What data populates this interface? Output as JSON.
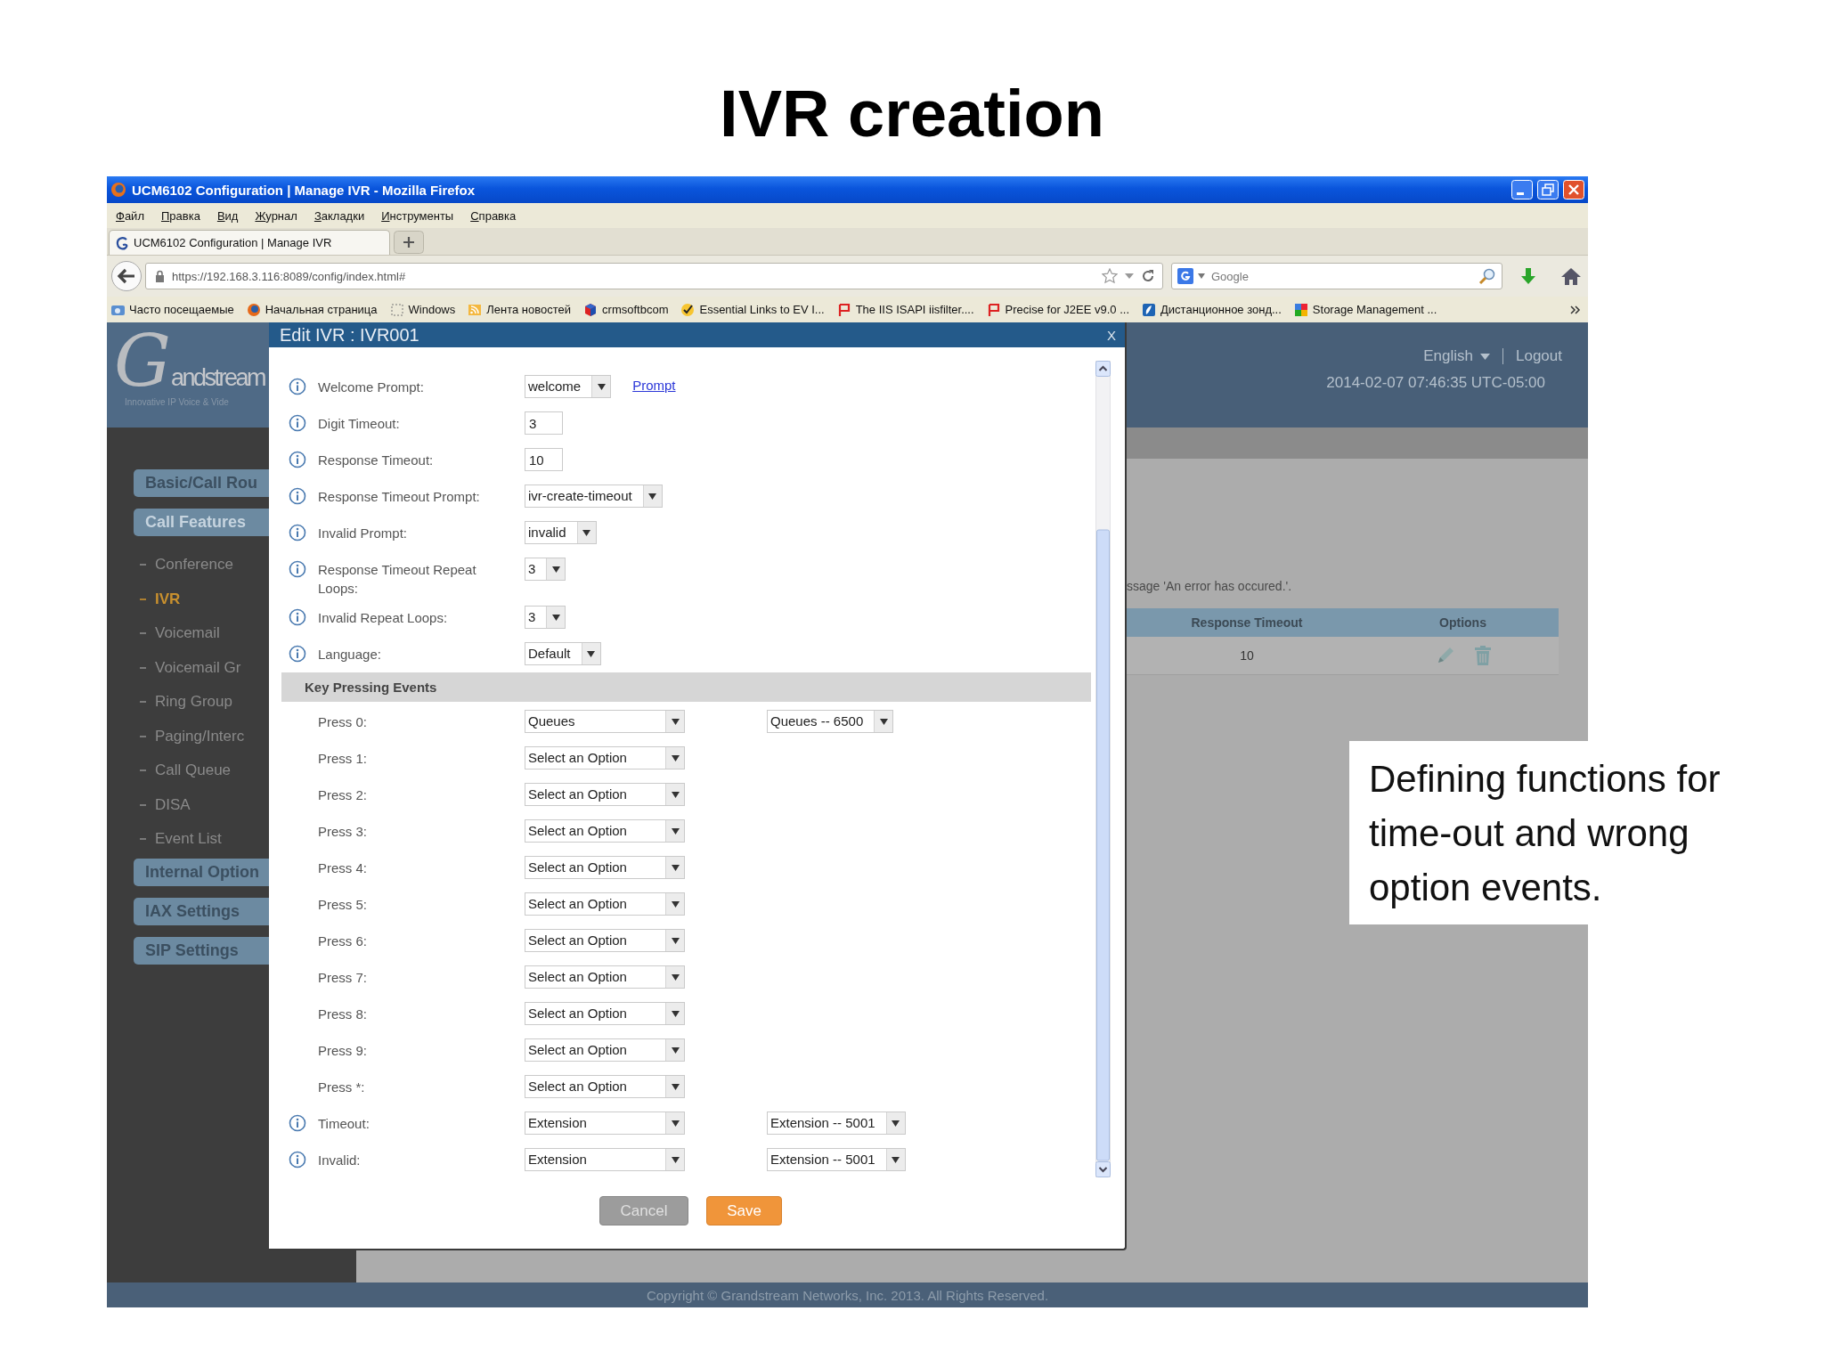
{
  "slide": {
    "title": "IVR creation",
    "callout": "Defining functions for\ntime-out and wrong\noption events."
  },
  "window": {
    "title": "UCM6102 Configuration | Manage IVR - Mozilla Firefox"
  },
  "menu": [
    "Файл",
    "Правка",
    "Вид",
    "Журнал",
    "Закладки",
    "Инструменты",
    "Справка"
  ],
  "tabs": [
    {
      "label": "UCM6102 Configuration | Manage IVR",
      "selected": true
    }
  ],
  "address_bar": {
    "url": "https://192.168.3.116:8089/config/index.html#"
  },
  "search": {
    "placeholder": "Google"
  },
  "bookmarks": [
    {
      "kind": "folder",
      "label": "Часто посещаемые"
    },
    {
      "kind": "globe",
      "label": "Начальная страница"
    },
    {
      "kind": "dashed",
      "label": "Windows"
    },
    {
      "kind": "feed",
      "label": "Лента новостей"
    },
    {
      "kind": "cube",
      "label": "crmsoftbcom"
    },
    {
      "kind": "check",
      "label": "Essential Links to EV I..."
    },
    {
      "kind": "flag",
      "label": "The IIS ISAPI iisfilter...."
    },
    {
      "kind": "flag",
      "label": "Precise for J2EE v9.0 ..."
    },
    {
      "kind": "tile",
      "label": "Дистанционное зонд..."
    },
    {
      "kind": "tiles",
      "label": "Storage Management ..."
    }
  ],
  "app": {
    "logo": {
      "initial": "G",
      "name": "andstream",
      "tagline": "Innovative IP Voice & Vide"
    },
    "language": "English",
    "logout": "Logout",
    "datetime": "2014-02-07 07:46:35 UTC-05:00",
    "sidebar": [
      {
        "kind": "group",
        "label": "Basic/Call Rou",
        "selected": false
      },
      {
        "kind": "group",
        "label": "Call Features",
        "selected": true
      },
      {
        "kind": "item",
        "label": "Conference",
        "selected": false
      },
      {
        "kind": "item",
        "label": "IVR",
        "selected": true
      },
      {
        "kind": "item",
        "label": "Voicemail",
        "selected": false
      },
      {
        "kind": "item",
        "label": "Voicemail Gr",
        "selected": false
      },
      {
        "kind": "item",
        "label": "Ring Group",
        "selected": false
      },
      {
        "kind": "item",
        "label": "Paging/Interc",
        "selected": false
      },
      {
        "kind": "item",
        "label": "Call Queue",
        "selected": false
      },
      {
        "kind": "item",
        "label": "DISA",
        "selected": false
      },
      {
        "kind": "item",
        "label": "Event List",
        "selected": false
      },
      {
        "kind": "group",
        "label": "Internal Option",
        "selected": false
      },
      {
        "kind": "group",
        "label": "IAX Settings",
        "selected": false
      },
      {
        "kind": "group",
        "label": "SIP Settings",
        "selected": false
      }
    ],
    "message": "ssage 'An error has occured.'.",
    "table": {
      "columns": [
        "Response Timeout",
        "Options"
      ],
      "rows": [
        {
          "cells": [
            "10"
          ]
        }
      ]
    },
    "footer": "Copyright © Grandstream Networks, Inc. 2013. All Rights Reserved."
  },
  "dialog": {
    "title": "Edit IVR : IVR001",
    "close": "X",
    "fields": [
      {
        "kind": "select",
        "info": true,
        "label": "Welcome Prompt:",
        "value": "welcome",
        "link": "Prompt"
      },
      {
        "kind": "text",
        "info": true,
        "label": "Digit Timeout:",
        "value": "3"
      },
      {
        "kind": "text",
        "info": true,
        "label": "Response Timeout:",
        "value": "10"
      },
      {
        "kind": "select",
        "info": true,
        "label": "Response Timeout Prompt:",
        "value": "ivr-create-timeout"
      },
      {
        "kind": "select",
        "info": true,
        "label": "Invalid Prompt:",
        "value": "invalid"
      },
      {
        "kind": "select",
        "info": true,
        "label": "Response Timeout Repeat Loops:",
        "value": "3"
      },
      {
        "kind": "select",
        "info": true,
        "label": "Invalid Repeat Loops:",
        "value": "3"
      },
      {
        "kind": "select",
        "info": true,
        "label": "Language:",
        "value": "Default"
      }
    ],
    "section": "Key Pressing Events",
    "keys": [
      {
        "info": false,
        "label": "Press 0:",
        "value": "Queues",
        "target": "Queues -- 6500"
      },
      {
        "info": false,
        "label": "Press 1:",
        "value": "Select an Option"
      },
      {
        "info": false,
        "label": "Press 2:",
        "value": "Select an Option"
      },
      {
        "info": false,
        "label": "Press 3:",
        "value": "Select an Option"
      },
      {
        "info": false,
        "label": "Press 4:",
        "value": "Select an Option"
      },
      {
        "info": false,
        "label": "Press 5:",
        "value": "Select an Option"
      },
      {
        "info": false,
        "label": "Press 6:",
        "value": "Select an Option"
      },
      {
        "info": false,
        "label": "Press 7:",
        "value": "Select an Option"
      },
      {
        "info": false,
        "label": "Press 8:",
        "value": "Select an Option"
      },
      {
        "info": false,
        "label": "Press 9:",
        "value": "Select an Option"
      },
      {
        "info": false,
        "label": "Press *:",
        "value": "Select an Option"
      },
      {
        "info": true,
        "label": "Timeout:",
        "value": "Extension",
        "target": "Extension -- 5001"
      },
      {
        "info": true,
        "label": "Invalid:",
        "value": "Extension",
        "target": "Extension -- 5001"
      }
    ],
    "buttons": [
      {
        "kind": "cancel",
        "label": "Cancel"
      },
      {
        "kind": "save",
        "label": "Save"
      }
    ]
  }
}
